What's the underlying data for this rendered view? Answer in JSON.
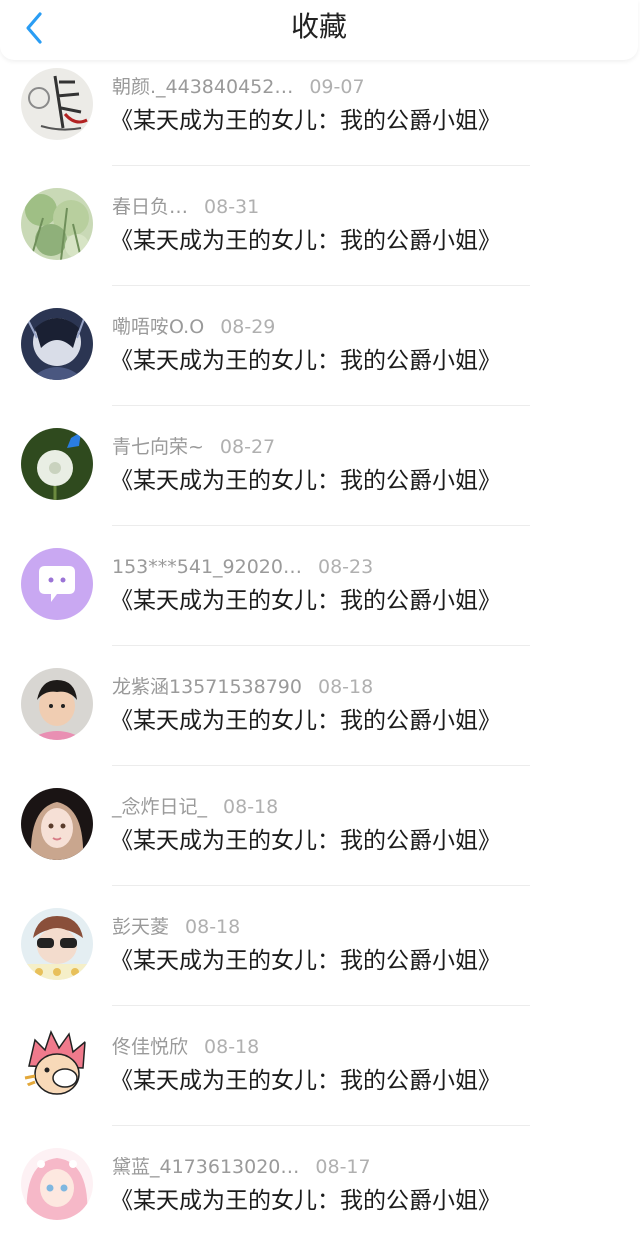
{
  "header": {
    "title": "收藏"
  },
  "items": [
    {
      "user": "朝颜._443840452…",
      "date": "09-07",
      "book": "《某天成为王的女儿：我的公爵小姐》",
      "avatar": "calligraphy-avatar"
    },
    {
      "user": "春日负…",
      "date": "08-31",
      "book": "《某天成为王的女儿：我的公爵小姐》",
      "avatar": "green-plants-avatar"
    },
    {
      "user": "嘞唔咹O.O",
      "date": "08-29",
      "book": "《某天成为王的女儿：我的公爵小姐》",
      "avatar": "dark-character-avatar"
    },
    {
      "user": "青七向荣~",
      "date": "08-27",
      "book": "《某天成为王的女儿：我的公爵小姐》",
      "avatar": "dandelion-avatar"
    },
    {
      "user": "153***541_92020…",
      "date": "08-23",
      "book": "《某天成为王的女儿：我的公爵小姐》",
      "avatar": "default-chat-bubble-avatar"
    },
    {
      "user": "龙紫涵13571538790",
      "date": "08-18",
      "book": "《某天成为王的女儿：我的公爵小姐》",
      "avatar": "child-photo-avatar"
    },
    {
      "user": "_念炸日记_",
      "date": "08-18",
      "book": "《某天成为王的女儿：我的公爵小姐》",
      "avatar": "doll-photo-avatar"
    },
    {
      "user": "彭天菱",
      "date": "08-18",
      "book": "《某天成为王的女儿：我的公爵小姐》",
      "avatar": "sunglasses-avatar"
    },
    {
      "user": "佟佳悦欣",
      "date": "08-18",
      "book": "《某天成为王的女儿：我的公爵小姐》",
      "avatar": "anime-pink-hair-avatar"
    },
    {
      "user": "黛蓝_4173613020…",
      "date": "08-17",
      "book": "《某天成为王的女儿：我的公爵小姐》",
      "avatar": "anime-girl-avatar"
    }
  ],
  "colors": {
    "accent": "#2a9df4",
    "title": "#222222",
    "meta": "#9a9a9a",
    "book": "#1c1c1c",
    "divider": "#ececec"
  }
}
